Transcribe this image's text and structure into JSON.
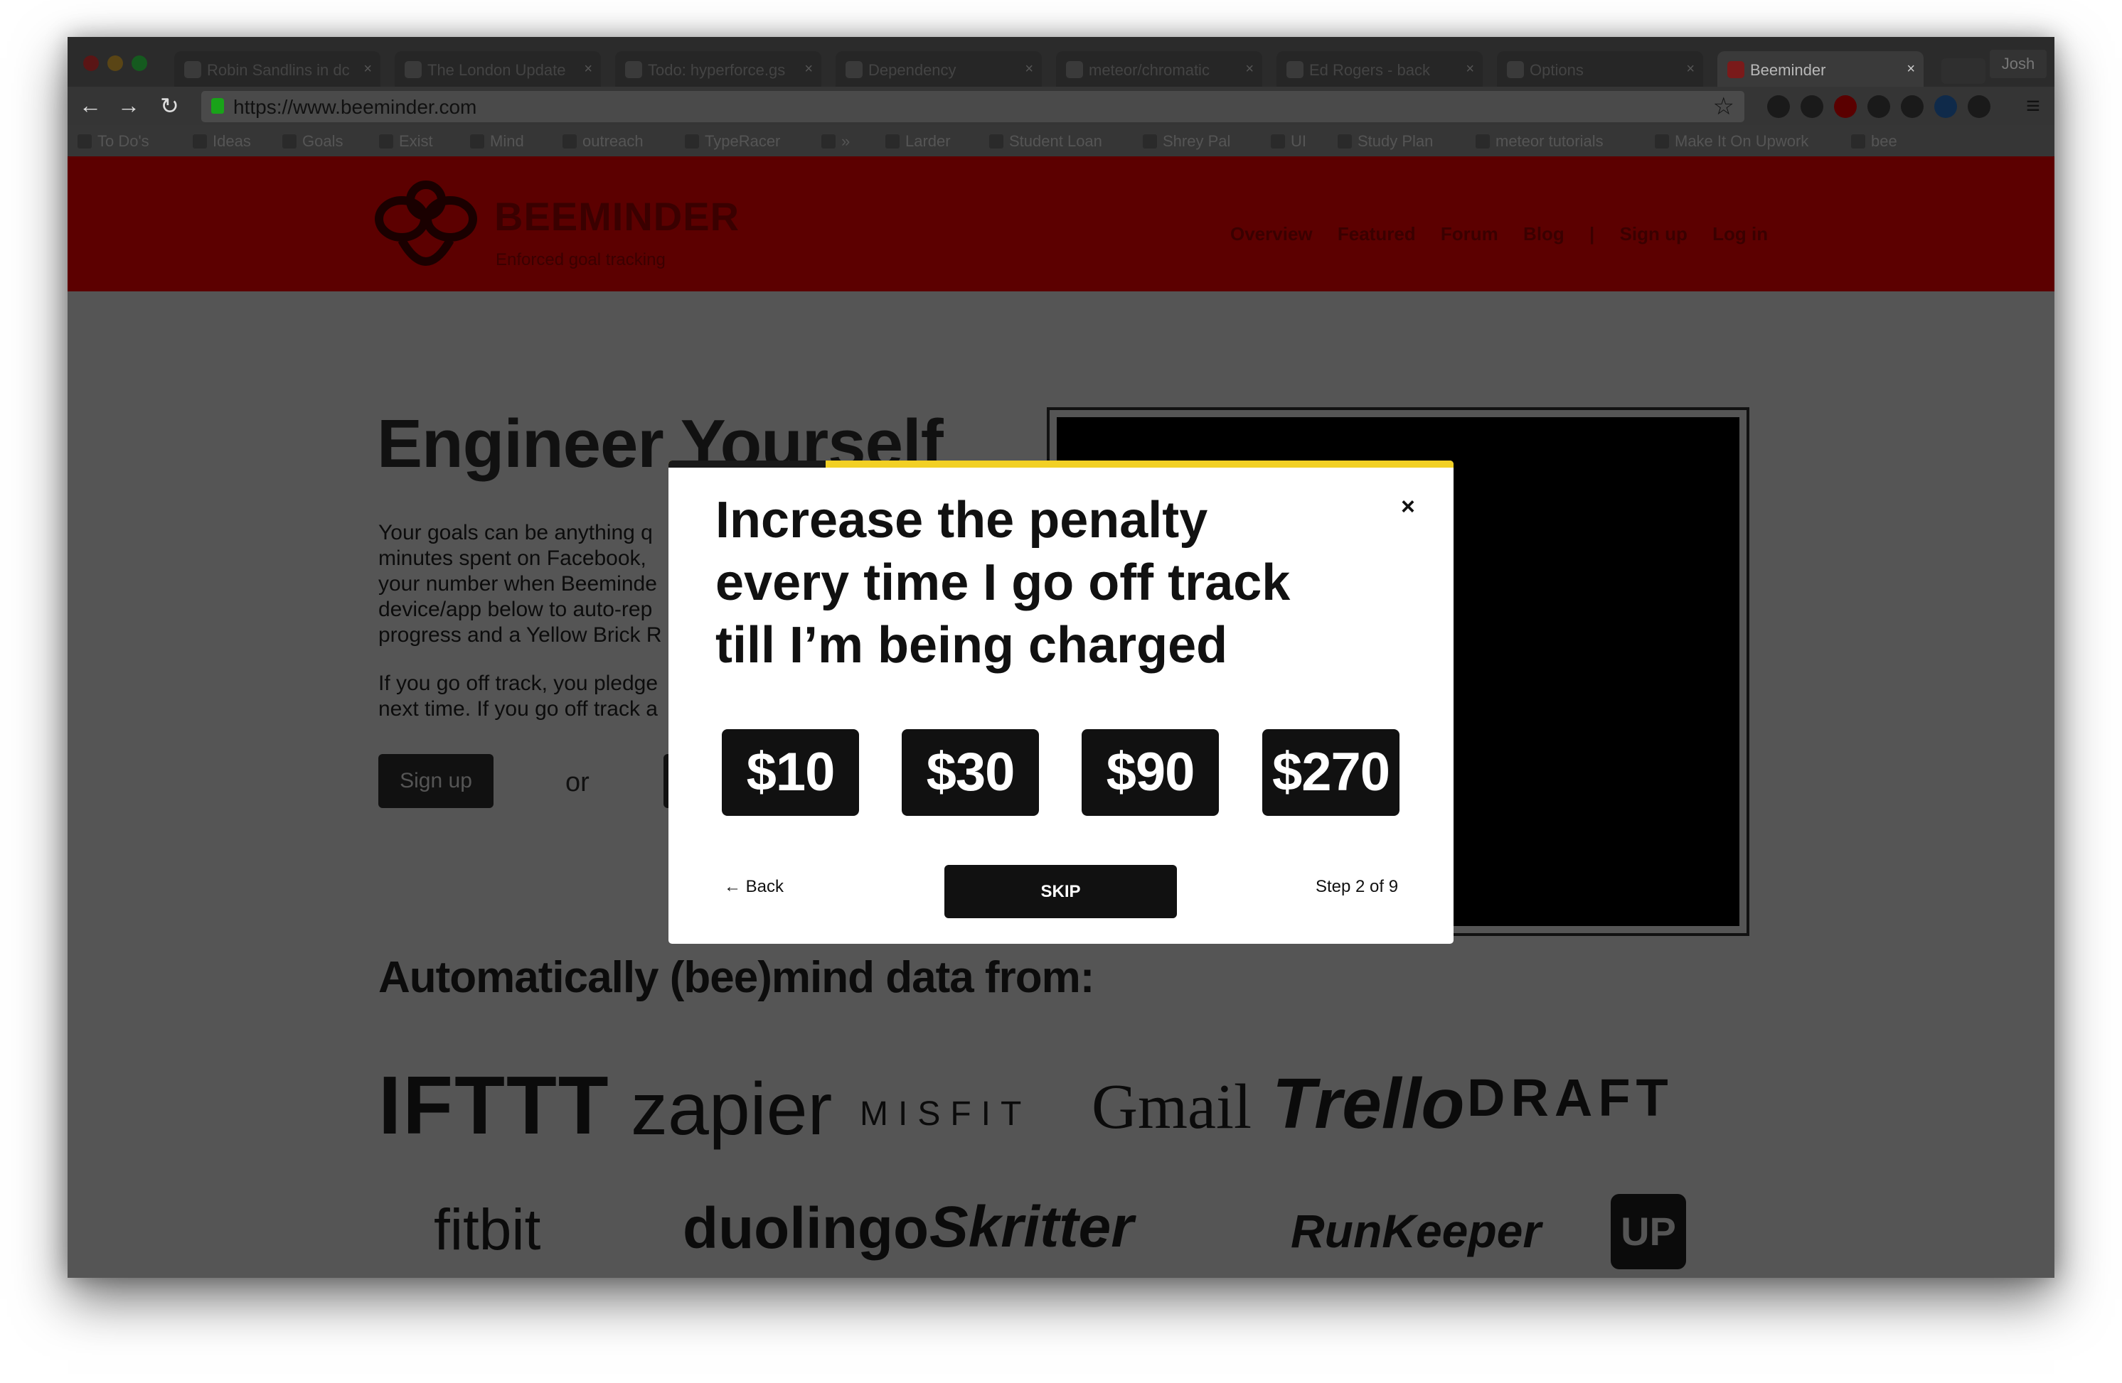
{
  "browser": {
    "tabs": [
      {
        "label": "Robin Sandlins in dc"
      },
      {
        "label": "The London Update"
      },
      {
        "label": "Todo: hyperforce.gs"
      },
      {
        "label": "Dependency"
      },
      {
        "label": "meteor/chromatic"
      },
      {
        "label": "Ed Rogers - back"
      },
      {
        "label": "Options"
      },
      {
        "label": "Beeminder"
      }
    ],
    "close_glyph": "×",
    "profile_name": "Josh",
    "url": "https://www.beeminder.com",
    "bookmarks": [
      {
        "label": "To Do's"
      },
      {
        "label": "Ideas"
      },
      {
        "label": "Goals"
      },
      {
        "label": "Exist"
      },
      {
        "label": "Mind"
      },
      {
        "label": "outreach"
      },
      {
        "label": "TypeRacer"
      },
      {
        "label": "»"
      },
      {
        "label": "Larder"
      },
      {
        "label": "Student Loan"
      },
      {
        "label": "Shrey Pal"
      },
      {
        "label": "UI"
      },
      {
        "label": "Study Plan"
      },
      {
        "label": "meteor tutorials"
      },
      {
        "label": "Make It On Upwork"
      },
      {
        "label": "bee"
      }
    ]
  },
  "site": {
    "brand": "BEEMINDER",
    "tagline": "Enforced goal tracking",
    "nav": [
      "Overview",
      "Featured",
      "Forum",
      "Blog",
      "|",
      "Sign up",
      "Log in"
    ],
    "hero_title": "Engineer Yourself",
    "para1_lines": [
      "Your goals can be anything q",
      "minutes spent on Facebook,",
      "your number when Beeminde",
      "device/app below to auto-rep",
      "progress and a Yellow Brick R"
    ],
    "para2_lines": [
      "If you go off track, you pledge",
      "next time. If you go off track a"
    ],
    "signup_label": "Sign up",
    "or_label": "or",
    "integrations_heading": "Automatically (bee)mind data from:",
    "integrations_row1": [
      "IFTTT",
      "zapier",
      "MISFIT",
      "Gmail",
      "Trello",
      "DRAFT"
    ],
    "integrations_row2": [
      "fitbit",
      "duolingo",
      "Skritter",
      "RunKeeper",
      "UP"
    ]
  },
  "modal": {
    "title_lines": [
      "Increase the penalty",
      "every time I go off track",
      "till I’m being charged"
    ],
    "close_label": "×",
    "amounts": [
      "$10",
      "$30",
      "$90",
      "$270"
    ],
    "back_label": "← Back",
    "skip_label": "SKIP",
    "step_label": "Step 2 of 9",
    "progress": 0.2
  },
  "colors": {
    "accent": "#f2d024",
    "brand_red": "#5c0000"
  }
}
